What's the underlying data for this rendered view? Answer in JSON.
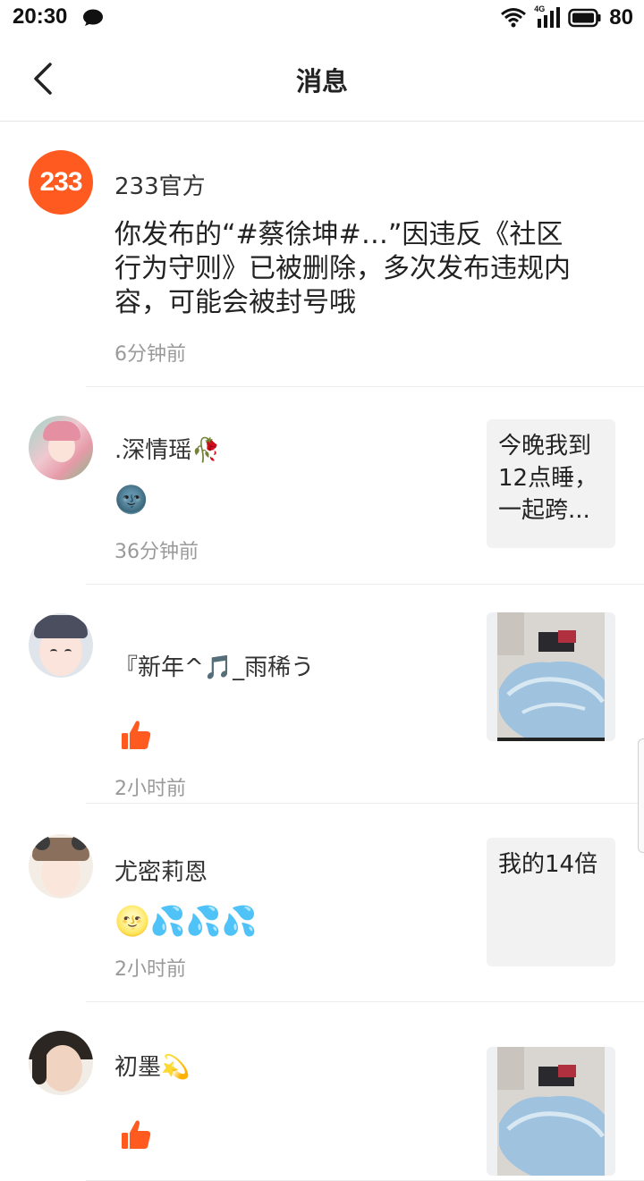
{
  "status_bar": {
    "time": "20:30",
    "network": "4G",
    "battery": "80"
  },
  "header": {
    "title": "消息"
  },
  "messages": [
    {
      "name": "233官方",
      "avatar_text": "233",
      "content": "你发布的“#蔡徐坤#…”因违反《社区行为守则》已被删除，多次发布违规内容，可能会被封号哦",
      "time": "6分钟前"
    },
    {
      "name": ".深情瑶🥀",
      "content": "🌚",
      "time": "36分钟前",
      "preview_text": "今晚我到12点睡，一起跨..."
    },
    {
      "name": "『新年^🎵_雨稀う",
      "content": "",
      "time": "2小时前"
    },
    {
      "name": "尤密莉恩",
      "content": "🌝💦💦💦",
      "time": "2小时前",
      "preview_text": "我的14倍"
    },
    {
      "name": "初墨💫",
      "content": "",
      "time": ""
    }
  ],
  "colors": {
    "brand": "#ff5a1f",
    "like": "#ff5a1f",
    "divider": "#ececec"
  }
}
